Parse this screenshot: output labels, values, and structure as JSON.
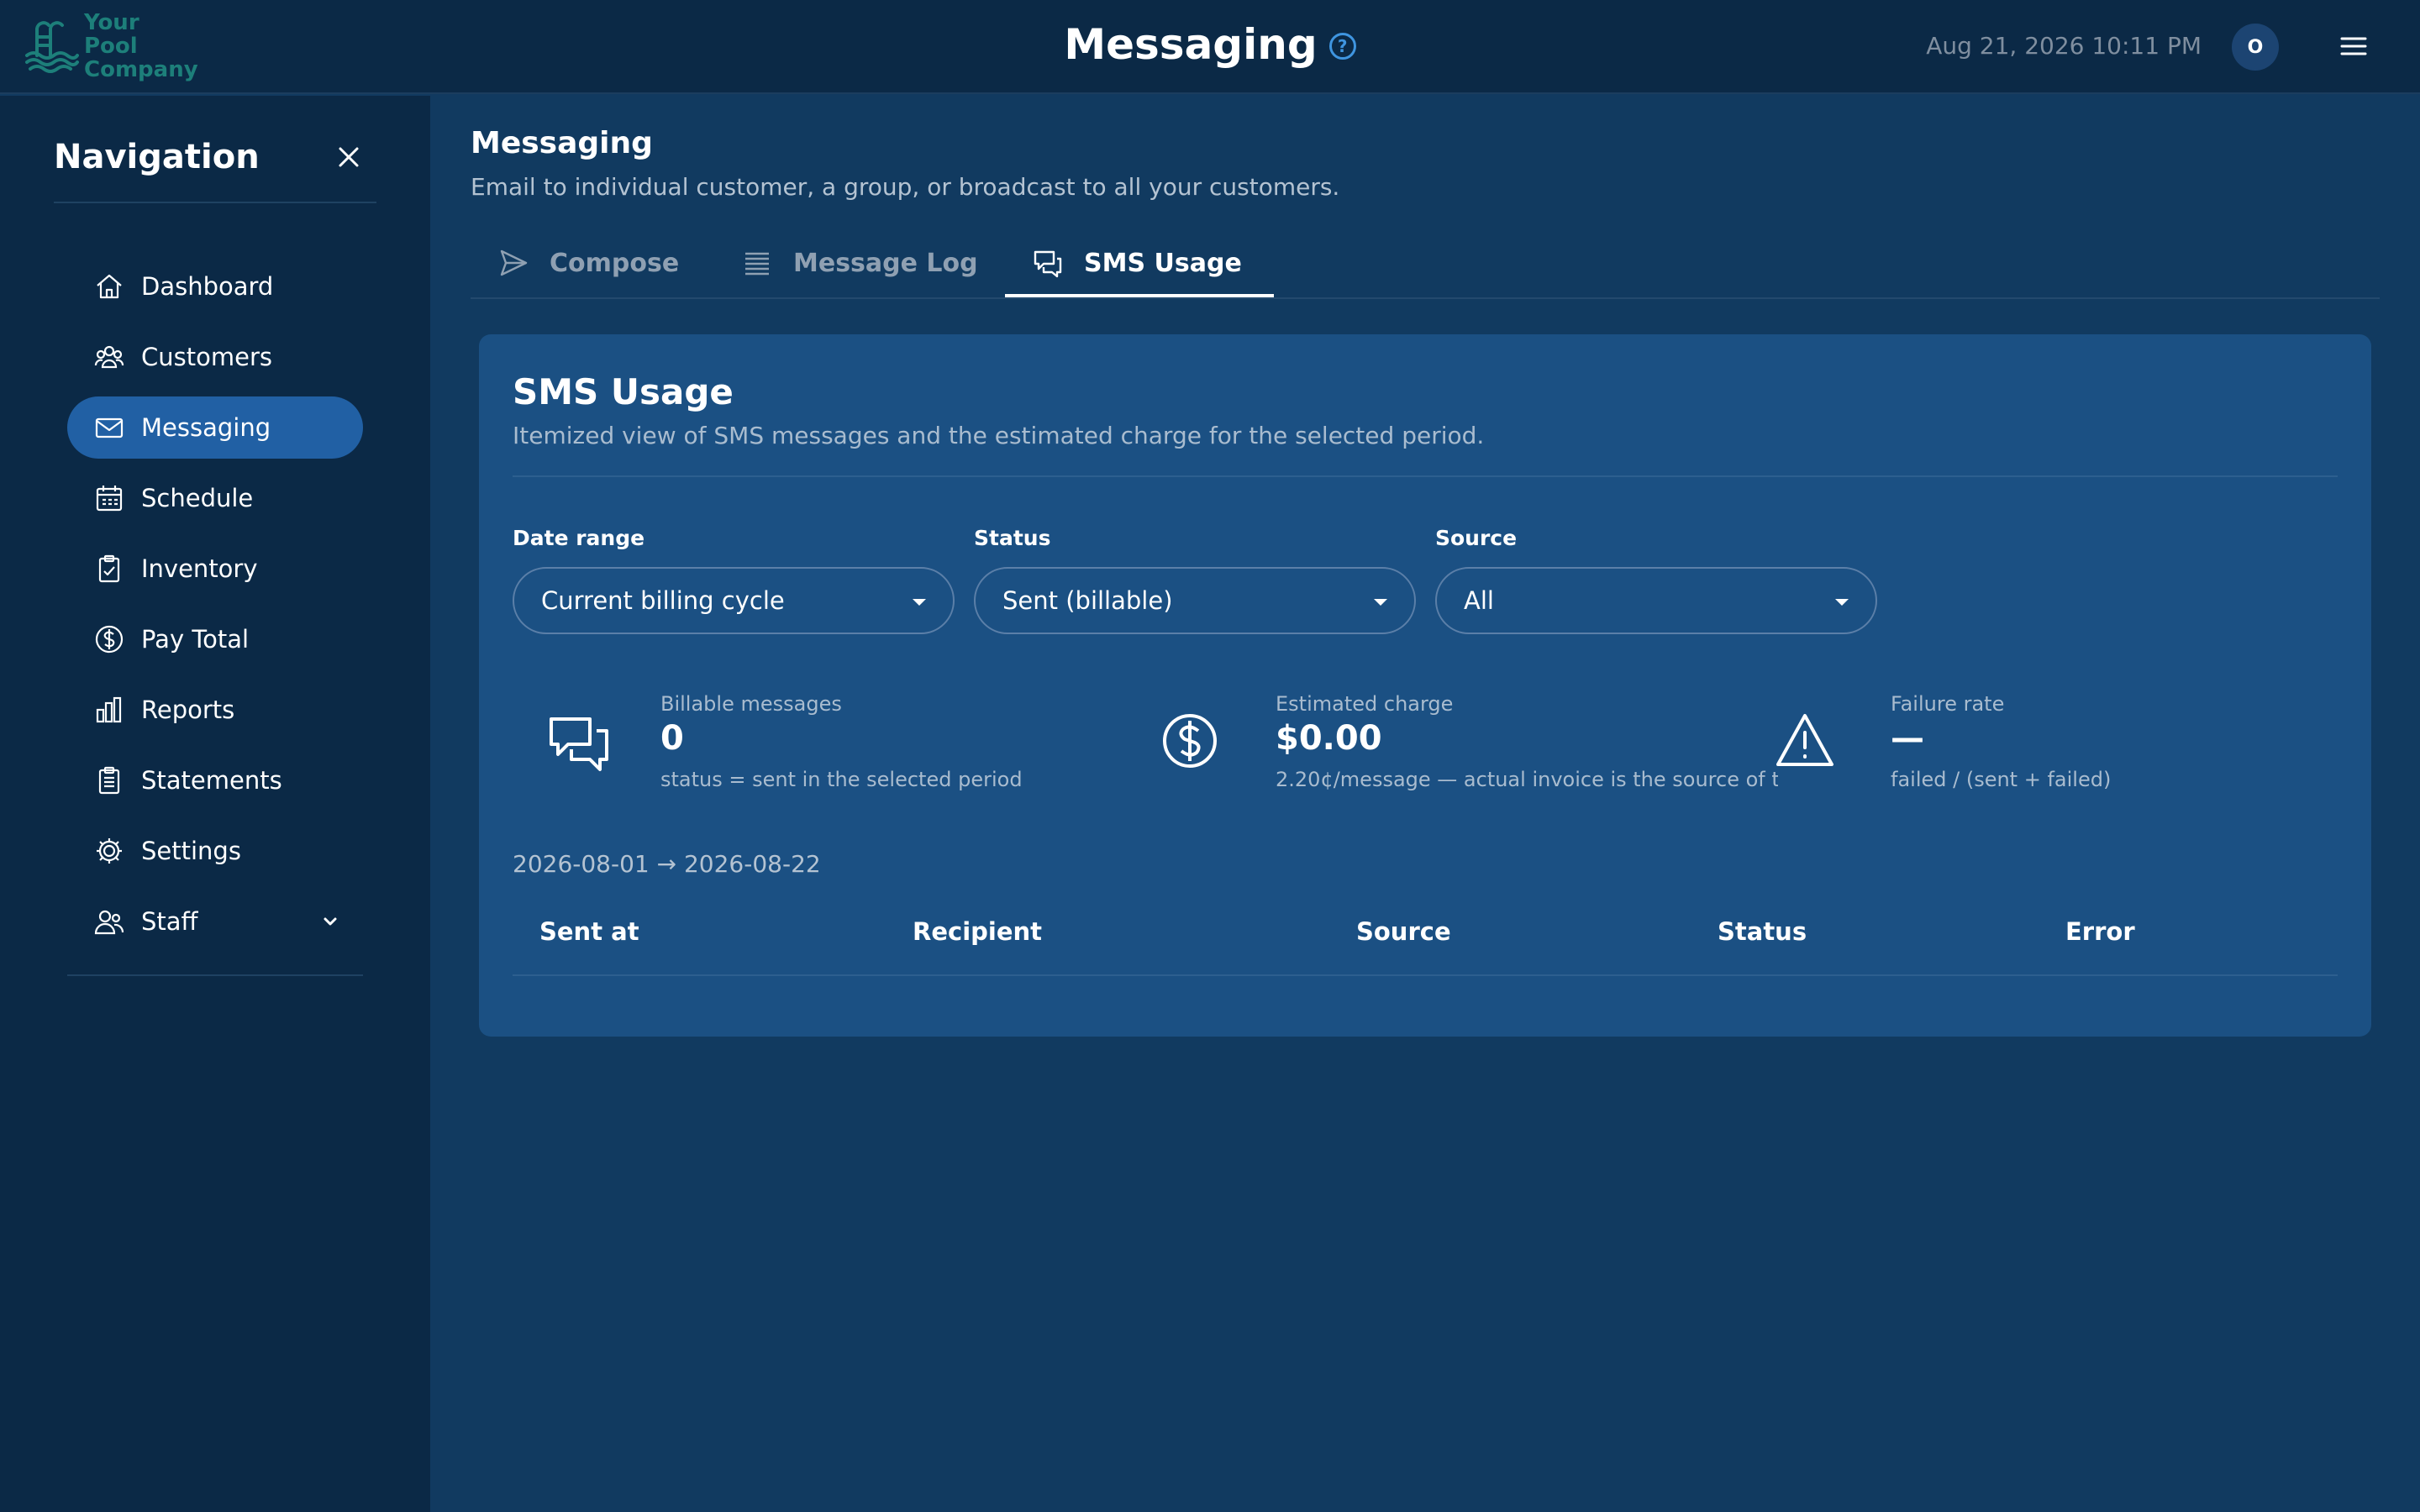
{
  "header": {
    "logo_text": "Your Pool Company",
    "title": "Messaging",
    "help": "?",
    "datetime": "Aug 21, 2026 10:11 PM",
    "avatar_initial": "O"
  },
  "sidebar": {
    "title": "Navigation",
    "items": [
      {
        "label": "Dashboard",
        "icon": "home-icon",
        "active": false
      },
      {
        "label": "Customers",
        "icon": "customers-icon",
        "active": false
      },
      {
        "label": "Messaging",
        "icon": "envelope-icon",
        "active": true
      },
      {
        "label": "Schedule",
        "icon": "calendar-icon",
        "active": false
      },
      {
        "label": "Inventory",
        "icon": "clipboard-check-icon",
        "active": false
      },
      {
        "label": "Pay Total",
        "icon": "dollar-circle-icon",
        "active": false
      },
      {
        "label": "Reports",
        "icon": "bar-chart-icon",
        "active": false
      },
      {
        "label": "Statements",
        "icon": "clipboard-list-icon",
        "active": false
      },
      {
        "label": "Settings",
        "icon": "gear-icon",
        "active": false
      },
      {
        "label": "Staff",
        "icon": "staff-icon",
        "active": false,
        "expandable": true
      }
    ]
  },
  "main": {
    "title": "Messaging",
    "subtitle": "Email to individual customer, a group, or broadcast to all your customers.",
    "tabs": [
      {
        "label": "Compose",
        "icon": "send-icon",
        "active": false
      },
      {
        "label": "Message Log",
        "icon": "list-icon",
        "active": false
      },
      {
        "label": "SMS Usage",
        "icon": "chat-icon",
        "active": true
      }
    ]
  },
  "sms_usage": {
    "title": "SMS Usage",
    "subtitle": "Itemized view of SMS messages and the estimated charge for the selected period.",
    "filters": {
      "date_range": {
        "label": "Date range",
        "value": "Current billing cycle"
      },
      "status": {
        "label": "Status",
        "value": "Sent (billable)"
      },
      "source": {
        "label": "Source",
        "value": "All"
      }
    },
    "stats": {
      "billable": {
        "label": "Billable messages",
        "value": "0",
        "note": "status = sent in the selected period"
      },
      "charge": {
        "label": "Estimated charge",
        "value": "$0.00",
        "note": "2.20¢/message — actual invoice is the source of t"
      },
      "failure": {
        "label": "Failure rate",
        "value": "—",
        "note": "failed / (sent + failed)"
      }
    },
    "range_text": "2026-08-01 → 2026-08-22",
    "table": {
      "columns": [
        "Sent at",
        "Recipient",
        "Source",
        "Status",
        "Error"
      ],
      "rows": []
    }
  },
  "colors": {
    "page_bg": "#113a60",
    "topbar_bg": "#0b2946",
    "card_bg": "#1b5083",
    "active_nav": "#2160a4",
    "accent": "#3f95e0",
    "logo": "#1d7f7a"
  }
}
